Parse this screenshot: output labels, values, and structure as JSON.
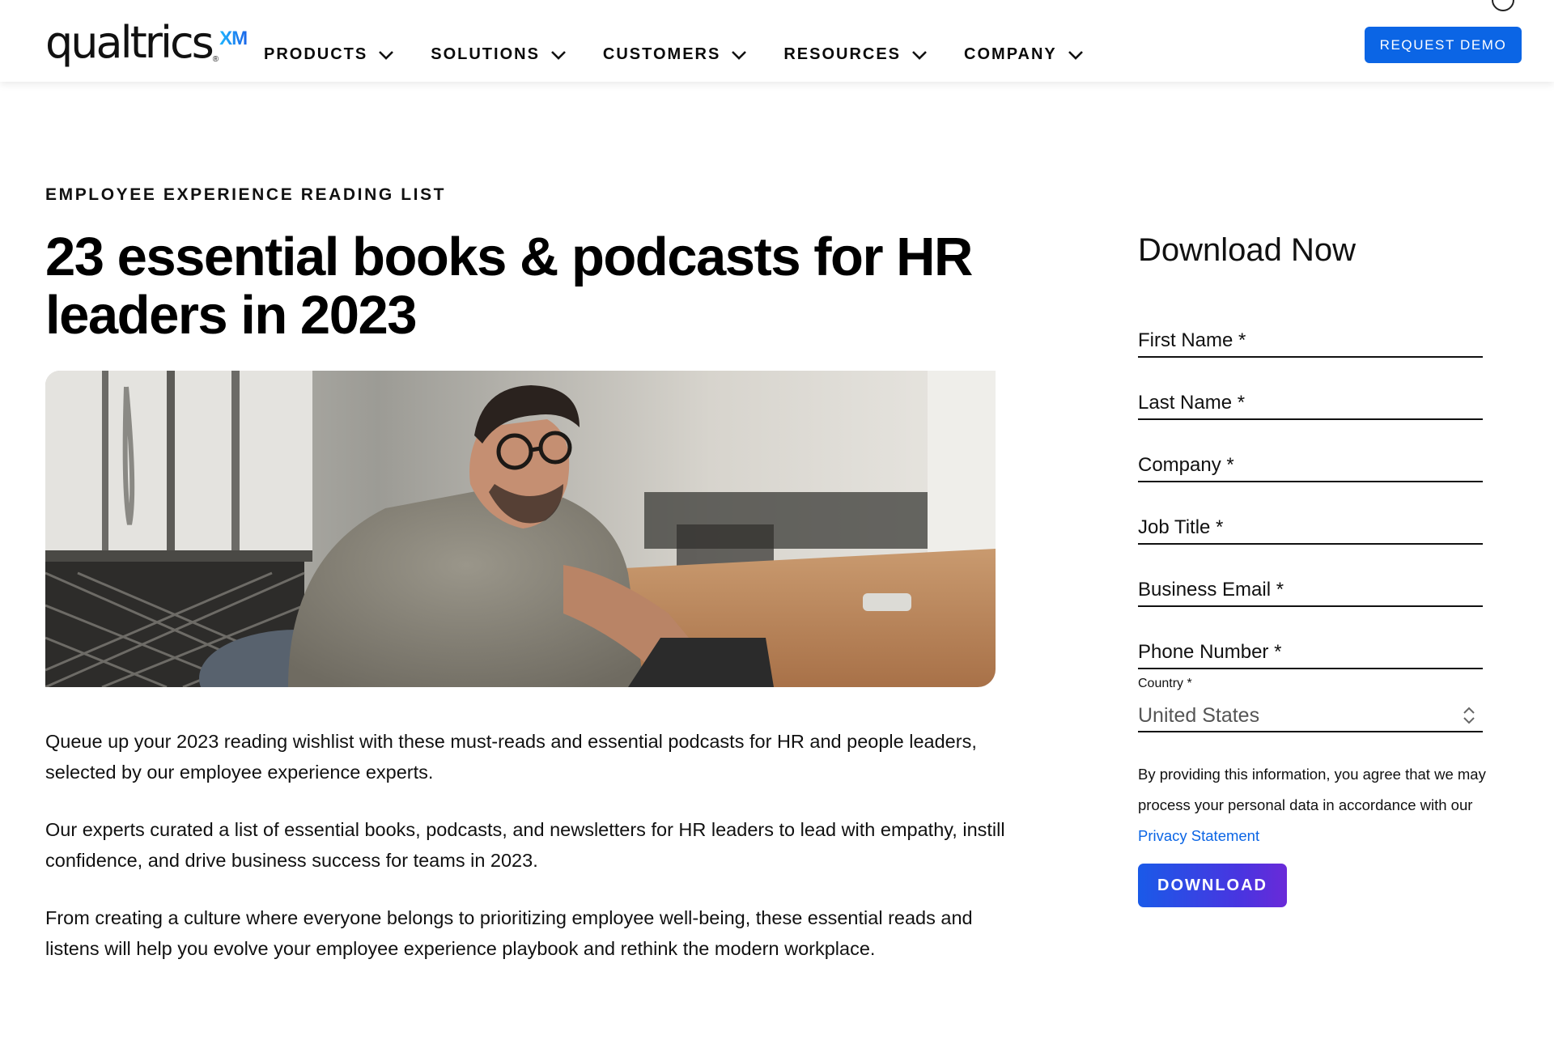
{
  "header": {
    "logo_word": "qualtrics",
    "logo_reg": "®",
    "logo_xm": "XM",
    "nav": [
      {
        "label": "PRODUCTS",
        "icon": "chevron-down-icon"
      },
      {
        "label": "SOLUTIONS",
        "icon": "chevron-down-icon"
      },
      {
        "label": "CUSTOMERS",
        "icon": "chevron-down-icon"
      },
      {
        "label": "RESOURCES",
        "icon": "chevron-down-icon"
      },
      {
        "label": "COMPANY",
        "icon": "chevron-down-icon"
      }
    ],
    "demo_label": "REQUEST DEMO",
    "brand_color": "#0b65e5"
  },
  "article": {
    "eyebrow": "EMPLOYEE EXPERIENCE READING LIST",
    "title": "23 essential books & podcasts for HR leaders in 2023",
    "hero_alt": "man-with-glasses-reading-tablet",
    "paragraphs": [
      "Queue up your 2023 reading wishlist with these must-reads and essential podcasts for HR and people leaders, selected by our employee experience experts.",
      "Our experts curated a list of essential books, podcasts, and newsletters for HR leaders to lead with empathy, instill confidence, and drive business success for teams in 2023.",
      "From creating a culture where everyone belongs to prioritizing employee well-being, these essential reads and listens will help you evolve your employee experience playbook and rethink the modern workplace."
    ]
  },
  "form": {
    "title": "Download Now",
    "fields": [
      {
        "placeholder": "First Name *",
        "value": ""
      },
      {
        "placeholder": "Last Name *",
        "value": ""
      },
      {
        "placeholder": "Company *",
        "value": ""
      },
      {
        "placeholder": "Job Title *",
        "value": ""
      },
      {
        "placeholder": "Business Email *",
        "value": ""
      },
      {
        "placeholder": "Phone Number *",
        "value": ""
      }
    ],
    "country_label": "Country *",
    "country_value": "United States",
    "consent_text": "By providing this information, you agree that we may process your personal data in accordance with our ",
    "privacy_link": "Privacy Statement",
    "download_label": "DOWNLOAD",
    "link_color": "#0b65e5"
  }
}
